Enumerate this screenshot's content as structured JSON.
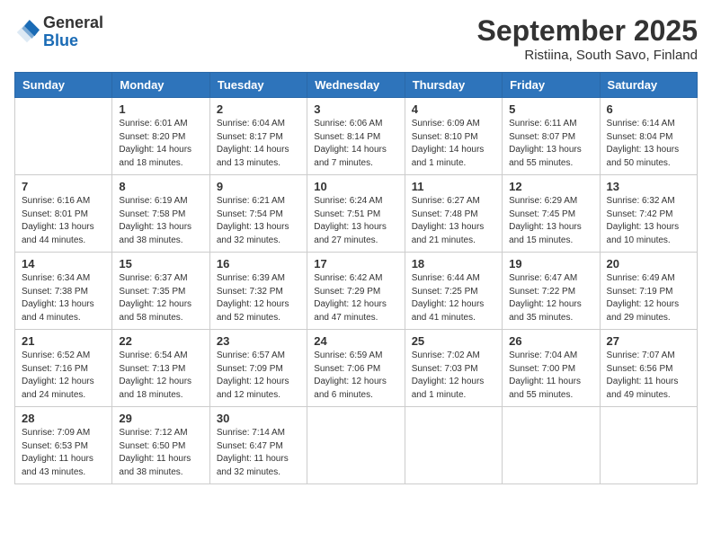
{
  "header": {
    "logo_general": "General",
    "logo_blue": "Blue",
    "month_title": "September 2025",
    "location": "Ristiina, South Savo, Finland"
  },
  "weekdays": [
    "Sunday",
    "Monday",
    "Tuesday",
    "Wednesday",
    "Thursday",
    "Friday",
    "Saturday"
  ],
  "weeks": [
    [
      {
        "day": "",
        "info": ""
      },
      {
        "day": "1",
        "info": "Sunrise: 6:01 AM\nSunset: 8:20 PM\nDaylight: 14 hours\nand 18 minutes."
      },
      {
        "day": "2",
        "info": "Sunrise: 6:04 AM\nSunset: 8:17 PM\nDaylight: 14 hours\nand 13 minutes."
      },
      {
        "day": "3",
        "info": "Sunrise: 6:06 AM\nSunset: 8:14 PM\nDaylight: 14 hours\nand 7 minutes."
      },
      {
        "day": "4",
        "info": "Sunrise: 6:09 AM\nSunset: 8:10 PM\nDaylight: 14 hours\nand 1 minute."
      },
      {
        "day": "5",
        "info": "Sunrise: 6:11 AM\nSunset: 8:07 PM\nDaylight: 13 hours\nand 55 minutes."
      },
      {
        "day": "6",
        "info": "Sunrise: 6:14 AM\nSunset: 8:04 PM\nDaylight: 13 hours\nand 50 minutes."
      }
    ],
    [
      {
        "day": "7",
        "info": "Sunrise: 6:16 AM\nSunset: 8:01 PM\nDaylight: 13 hours\nand 44 minutes."
      },
      {
        "day": "8",
        "info": "Sunrise: 6:19 AM\nSunset: 7:58 PM\nDaylight: 13 hours\nand 38 minutes."
      },
      {
        "day": "9",
        "info": "Sunrise: 6:21 AM\nSunset: 7:54 PM\nDaylight: 13 hours\nand 32 minutes."
      },
      {
        "day": "10",
        "info": "Sunrise: 6:24 AM\nSunset: 7:51 PM\nDaylight: 13 hours\nand 27 minutes."
      },
      {
        "day": "11",
        "info": "Sunrise: 6:27 AM\nSunset: 7:48 PM\nDaylight: 13 hours\nand 21 minutes."
      },
      {
        "day": "12",
        "info": "Sunrise: 6:29 AM\nSunset: 7:45 PM\nDaylight: 13 hours\nand 15 minutes."
      },
      {
        "day": "13",
        "info": "Sunrise: 6:32 AM\nSunset: 7:42 PM\nDaylight: 13 hours\nand 10 minutes."
      }
    ],
    [
      {
        "day": "14",
        "info": "Sunrise: 6:34 AM\nSunset: 7:38 PM\nDaylight: 13 hours\nand 4 minutes."
      },
      {
        "day": "15",
        "info": "Sunrise: 6:37 AM\nSunset: 7:35 PM\nDaylight: 12 hours\nand 58 minutes."
      },
      {
        "day": "16",
        "info": "Sunrise: 6:39 AM\nSunset: 7:32 PM\nDaylight: 12 hours\nand 52 minutes."
      },
      {
        "day": "17",
        "info": "Sunrise: 6:42 AM\nSunset: 7:29 PM\nDaylight: 12 hours\nand 47 minutes."
      },
      {
        "day": "18",
        "info": "Sunrise: 6:44 AM\nSunset: 7:25 PM\nDaylight: 12 hours\nand 41 minutes."
      },
      {
        "day": "19",
        "info": "Sunrise: 6:47 AM\nSunset: 7:22 PM\nDaylight: 12 hours\nand 35 minutes."
      },
      {
        "day": "20",
        "info": "Sunrise: 6:49 AM\nSunset: 7:19 PM\nDaylight: 12 hours\nand 29 minutes."
      }
    ],
    [
      {
        "day": "21",
        "info": "Sunrise: 6:52 AM\nSunset: 7:16 PM\nDaylight: 12 hours\nand 24 minutes."
      },
      {
        "day": "22",
        "info": "Sunrise: 6:54 AM\nSunset: 7:13 PM\nDaylight: 12 hours\nand 18 minutes."
      },
      {
        "day": "23",
        "info": "Sunrise: 6:57 AM\nSunset: 7:09 PM\nDaylight: 12 hours\nand 12 minutes."
      },
      {
        "day": "24",
        "info": "Sunrise: 6:59 AM\nSunset: 7:06 PM\nDaylight: 12 hours\nand 6 minutes."
      },
      {
        "day": "25",
        "info": "Sunrise: 7:02 AM\nSunset: 7:03 PM\nDaylight: 12 hours\nand 1 minute."
      },
      {
        "day": "26",
        "info": "Sunrise: 7:04 AM\nSunset: 7:00 PM\nDaylight: 11 hours\nand 55 minutes."
      },
      {
        "day": "27",
        "info": "Sunrise: 7:07 AM\nSunset: 6:56 PM\nDaylight: 11 hours\nand 49 minutes."
      }
    ],
    [
      {
        "day": "28",
        "info": "Sunrise: 7:09 AM\nSunset: 6:53 PM\nDaylight: 11 hours\nand 43 minutes."
      },
      {
        "day": "29",
        "info": "Sunrise: 7:12 AM\nSunset: 6:50 PM\nDaylight: 11 hours\nand 38 minutes."
      },
      {
        "day": "30",
        "info": "Sunrise: 7:14 AM\nSunset: 6:47 PM\nDaylight: 11 hours\nand 32 minutes."
      },
      {
        "day": "",
        "info": ""
      },
      {
        "day": "",
        "info": ""
      },
      {
        "day": "",
        "info": ""
      },
      {
        "day": "",
        "info": ""
      }
    ]
  ]
}
